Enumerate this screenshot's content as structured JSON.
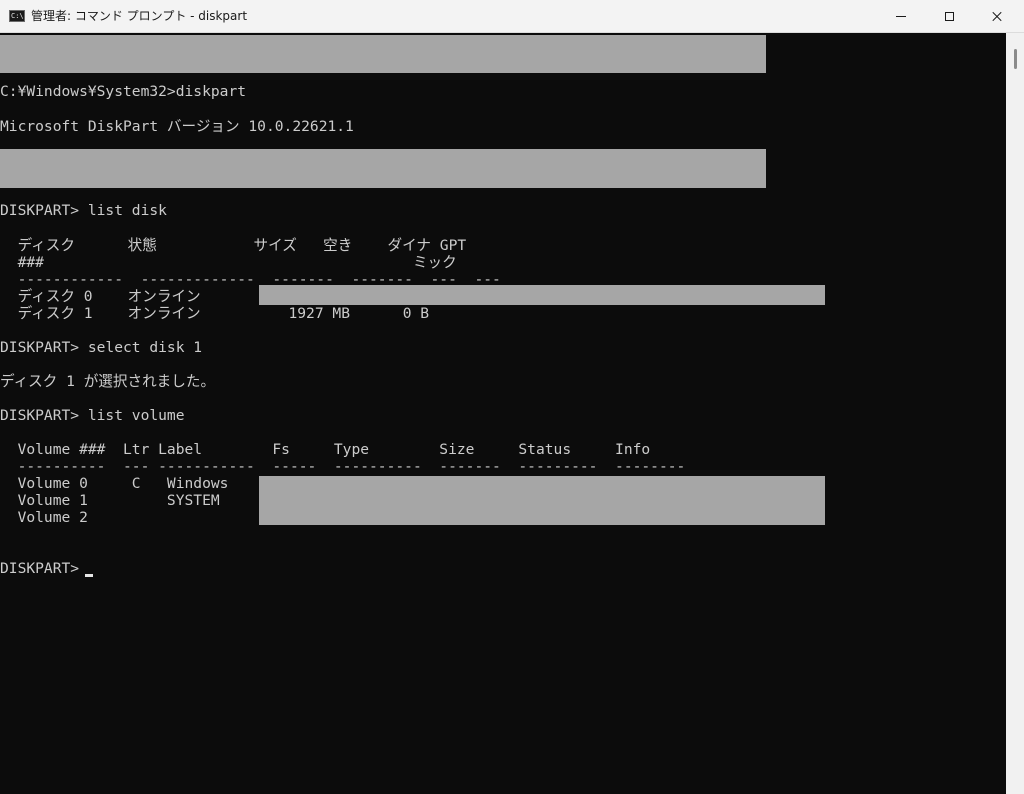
{
  "window": {
    "title": "管理者: コマンド プロンプト - diskpart",
    "icon_text": "C:\\",
    "controls": {
      "minimize": "minimize-icon",
      "maximize": "maximize-icon",
      "close": "close-icon"
    }
  },
  "console": {
    "lines": [
      "C:¥Windows¥System32>diskpart",
      "Microsoft DiskPart バージョン 10.0.22621.1",
      "DISKPART> list disk",
      "  ディスク      状態           サイズ   空き    ダイナ GPT",
      "  ###                                          ミック",
      "  ------------  -------------  -------  -------  ---  ---",
      "  ディスク 0    オンライン",
      "  ディスク 1    オンライン          1927 MB      0 B",
      "DISKPART> select disk 1",
      "ディスク 1 が選択されました。",
      "DISKPART> list volume",
      "  Volume ###  Ltr Label        Fs     Type        Size     Status     Info",
      "  ----------  --- -----------  -----  ----------  -------  ---------  --------",
      "  Volume 0     C   Windows",
      "  Volume 1         SYSTEM",
      "  Volume 2",
      "DISKPART> "
    ]
  },
  "colors": {
    "console_bg": "#0c0c0c",
    "console_text": "#cccccc",
    "titlebar_bg": "#f3f3f3",
    "redaction": "#a6a6a6"
  }
}
